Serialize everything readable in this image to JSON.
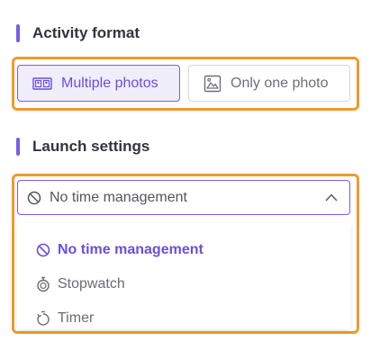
{
  "activity_format": {
    "title": "Activity format",
    "options": [
      {
        "label": "Multiple photos",
        "icon": "photos-icon",
        "selected": true
      },
      {
        "label": "Only one photo",
        "icon": "image-icon",
        "selected": false
      }
    ]
  },
  "launch_settings": {
    "title": "Launch settings",
    "selected_value": "No time management",
    "select_icon": "no-time-icon",
    "options": [
      {
        "label": "No time management",
        "icon": "no-time-icon",
        "active": true
      },
      {
        "label": "Stopwatch",
        "icon": "stopwatch-icon",
        "active": false
      },
      {
        "label": "Timer",
        "icon": "timer-icon",
        "active": false
      }
    ]
  },
  "colors": {
    "accent": "#7b5ce6",
    "highlight_frame": "#ef9a2e"
  }
}
